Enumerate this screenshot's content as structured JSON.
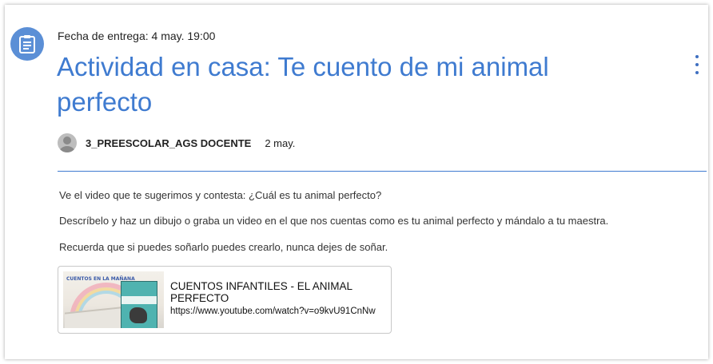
{
  "assignment": {
    "due_label": "Fecha de entrega: 4 may. 19:00",
    "title": "Actividad en casa: Te cuento de mi animal perfecto",
    "icon": "assignment-icon",
    "more_icon": "more-vert-icon"
  },
  "author": {
    "name": "3_PREESCOLAR_AGS DOCENTE",
    "posted_date": "2 may."
  },
  "instructions": {
    "p1": "Ve el video que te sugerimos y contesta: ¿Cuál es tu animal perfecto?",
    "p2": "Descríbelo y haz un dibujo o graba un video en el que nos cuentas como es tu animal perfecto y mándalo a tu maestra.",
    "p3": "Recuerda que si puedes soñarlo puedes crearlo, nunca dejes de soñar."
  },
  "attachment": {
    "title": "CUENTOS INFANTILES - EL ANIMAL PERFECTO",
    "url": "https://www.youtube.com/watch?v=o9kvU91CnNw",
    "thumbnail_text": "CUENTOS EN LA MAÑANA"
  },
  "colors": {
    "accent": "#3f7bd0",
    "icon_bg": "#5b8fd6"
  }
}
